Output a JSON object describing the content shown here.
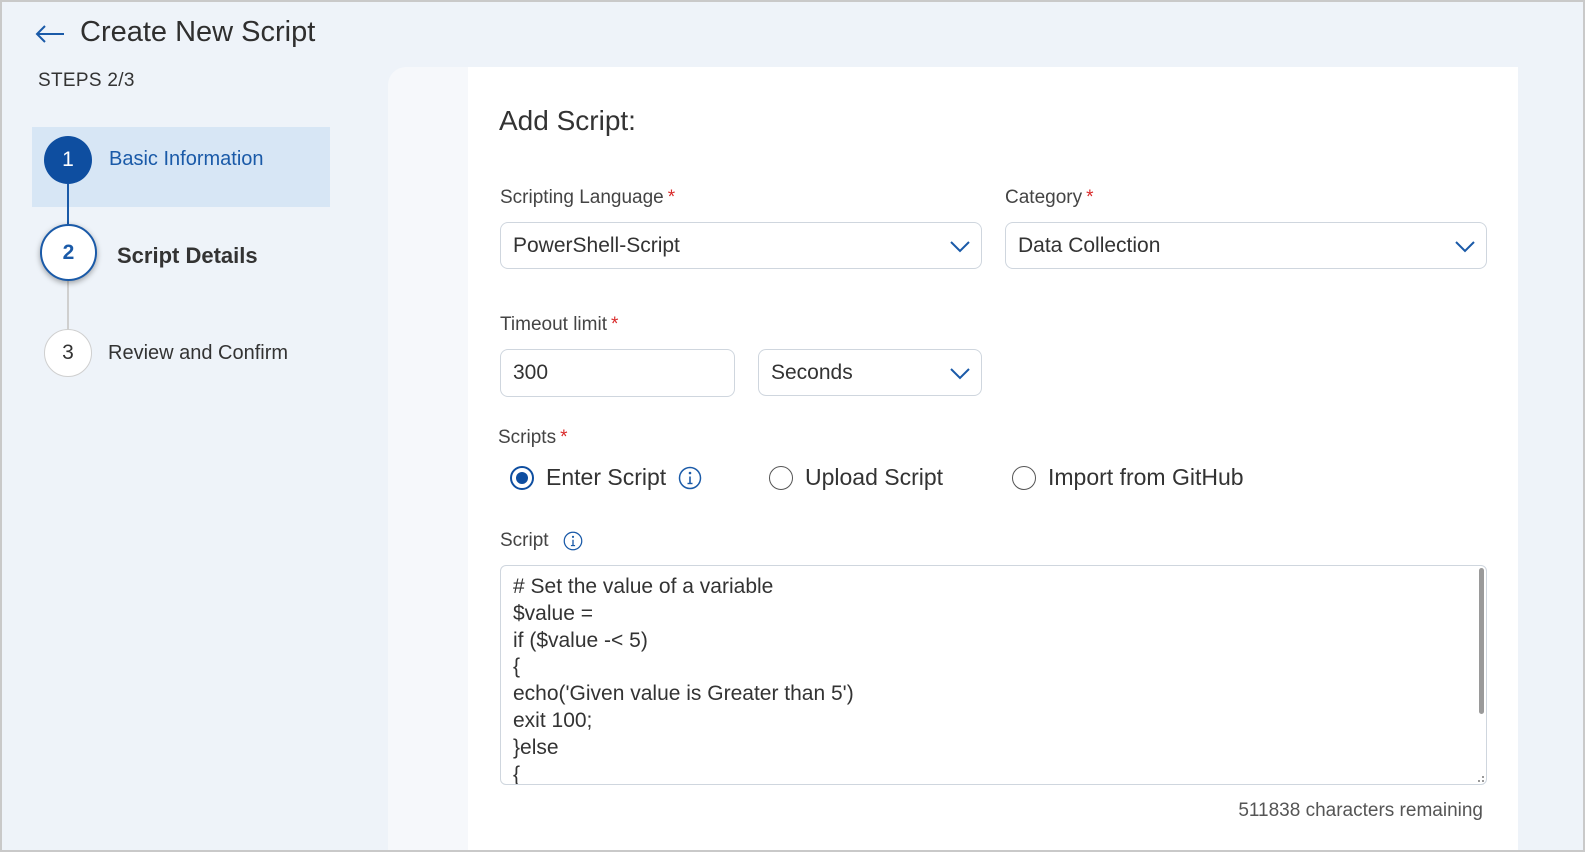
{
  "header": {
    "title": "Create New Script",
    "steps_label": "STEPS 2/3"
  },
  "stepper": {
    "steps": [
      {
        "number": "1",
        "label": "Basic Information",
        "state": "completed"
      },
      {
        "number": "2",
        "label": "Script Details",
        "state": "current"
      },
      {
        "number": "3",
        "label": "Review and Confirm",
        "state": "pending"
      }
    ]
  },
  "form": {
    "section_title": "Add Script:",
    "required_marker": "*",
    "scripting_language": {
      "label": "Scripting Language",
      "value": "PowerShell-Script"
    },
    "category": {
      "label": "Category",
      "value": "Data Collection"
    },
    "timeout": {
      "label": "Timeout limit",
      "value": "300",
      "unit": "Seconds"
    },
    "scripts": {
      "label": "Scripts",
      "options": [
        {
          "label": "Enter Script",
          "checked": true
        },
        {
          "label": "Upload Script",
          "checked": false
        },
        {
          "label": "Import from GitHub",
          "checked": false
        }
      ]
    },
    "script": {
      "label": "Script",
      "content": "# Set the value of a variable\n$value =\nif ($value -< 5)\n{\necho('Given value is Greater than 5')\nexit 100;\n}else\n{",
      "chars_remaining": "511838 characters remaining"
    }
  },
  "colors": {
    "accent": "#0e4ea0",
    "required": "#d92b2b",
    "active_step_bg": "#d7e6f5",
    "page_bg": "#eef3f9"
  }
}
